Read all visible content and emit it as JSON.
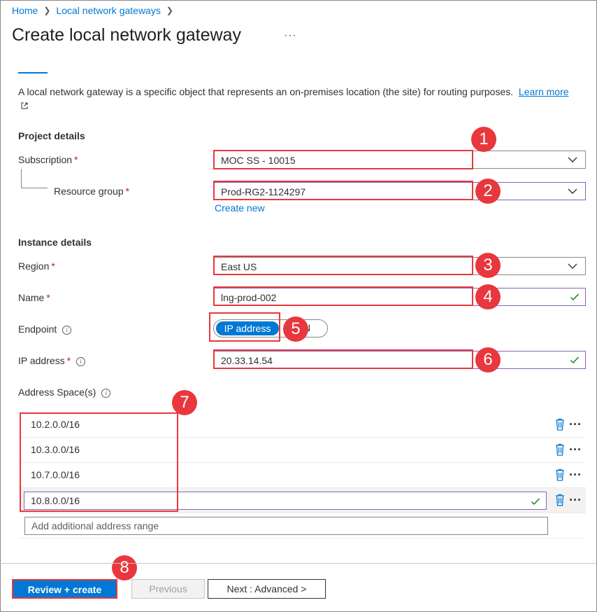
{
  "breadcrumb": {
    "items": [
      "Home",
      "Local network gateways"
    ]
  },
  "page": {
    "title": "Create local network gateway",
    "more_icon": "ellipsis-icon",
    "description": "A local network gateway is a specific object that represents an on-premises location (the site) for routing purposes.",
    "learn_more": "Learn more"
  },
  "project": {
    "heading": "Project details",
    "subscription_label": "Subscription",
    "subscription_value": "MOC SS - 10015",
    "resource_group_label": "Resource group",
    "resource_group_value": "Prod-RG2-1124297",
    "create_new": "Create new"
  },
  "instance": {
    "heading": "Instance details",
    "region_label": "Region",
    "region_value": "East US",
    "name_label": "Name",
    "name_value": "lng-prod-002",
    "endpoint_label": "Endpoint",
    "endpoint_on": "IP address",
    "endpoint_off": "N",
    "ip_label": "IP address",
    "ip_value": "20.33.14.54",
    "address_space_label": "Address Space(s)"
  },
  "address_spaces": [
    "10.2.0.0/16",
    "10.3.0.0/16",
    "10.7.0.0/16",
    "10.8.0.0/16"
  ],
  "address_placeholder": "Add additional address range",
  "required_mark": "*",
  "callouts": [
    "1",
    "2",
    "3",
    "4",
    "5",
    "6",
    "7",
    "8"
  ],
  "footer": {
    "review_create": "Review + create",
    "previous": "Previous",
    "next": "Next : Advanced >"
  },
  "colors": {
    "accent": "#0078d4",
    "callout": "#e8373d",
    "valid": "#107c10",
    "required": "#a4262c"
  }
}
